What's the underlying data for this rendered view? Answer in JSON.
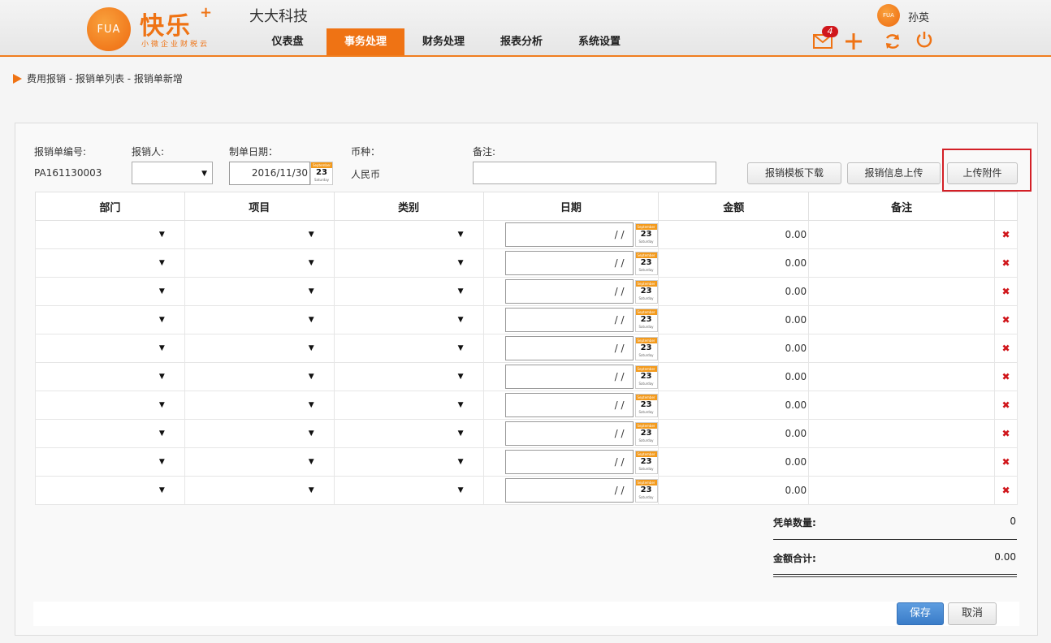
{
  "header": {
    "logo_badge": "FUA",
    "logo_text": "快乐",
    "logo_plus": "+",
    "logo_sub": "小微企业财税云",
    "company": "大大科技",
    "nav": [
      {
        "label": "仪表盘"
      },
      {
        "label": "事务处理"
      },
      {
        "label": "财务处理"
      },
      {
        "label": "报表分析"
      },
      {
        "label": "系统设置"
      }
    ],
    "active_nav": "事务处理",
    "user_badge": "FUA",
    "user_name": "孙英",
    "mail_count": "4",
    "icons": [
      "mail-icon",
      "plus-icon",
      "refresh-icon",
      "power-icon"
    ],
    "accent_color": "#ef7314"
  },
  "breadcrumb": "费用报销 - 报销单列表 - 报销单新增",
  "form": {
    "number_label": "报销单编号:",
    "number_value": "PA161130003",
    "reporter_label": "报销人:",
    "reporter_value": "",
    "date_label": "制单日期：",
    "date_value": "2016/11/30",
    "currency_label": "币种：",
    "currency_value": "人民币",
    "remark_label": "备注:",
    "remark_value": ""
  },
  "calendar_icon": {
    "month": "September",
    "day": "23",
    "weekday": "Saturday"
  },
  "buttons": {
    "template_download": "报销模板下载",
    "info_upload": "报销信息上传",
    "attach_upload": "上传附件"
  },
  "table": {
    "headers": [
      "部门",
      "项目",
      "类别",
      "日期",
      "金额",
      "备注",
      ""
    ],
    "rows": [
      {
        "dept": "",
        "item": "",
        "type": "",
        "date": "/ /",
        "amount": "0.00",
        "remark": ""
      },
      {
        "dept": "",
        "item": "",
        "type": "",
        "date": "/ /",
        "amount": "0.00",
        "remark": ""
      },
      {
        "dept": "",
        "item": "",
        "type": "",
        "date": "/ /",
        "amount": "0.00",
        "remark": ""
      },
      {
        "dept": "",
        "item": "",
        "type": "",
        "date": "/ /",
        "amount": "0.00",
        "remark": ""
      },
      {
        "dept": "",
        "item": "",
        "type": "",
        "date": "/ /",
        "amount": "0.00",
        "remark": ""
      },
      {
        "dept": "",
        "item": "",
        "type": "",
        "date": "/ /",
        "amount": "0.00",
        "remark": ""
      },
      {
        "dept": "",
        "item": "",
        "type": "",
        "date": "/ /",
        "amount": "0.00",
        "remark": ""
      },
      {
        "dept": "",
        "item": "",
        "type": "",
        "date": "/ /",
        "amount": "0.00",
        "remark": ""
      },
      {
        "dept": "",
        "item": "",
        "type": "",
        "date": "/ /",
        "amount": "0.00",
        "remark": ""
      },
      {
        "dept": "",
        "item": "",
        "type": "",
        "date": "/ /",
        "amount": "0.00",
        "remark": ""
      }
    ]
  },
  "summary": {
    "count_label": "凭单数量:",
    "count_value": "0",
    "total_label": "金额合计:",
    "total_value": "0.00"
  },
  "footer": {
    "save": "保存",
    "cancel": "取消"
  }
}
